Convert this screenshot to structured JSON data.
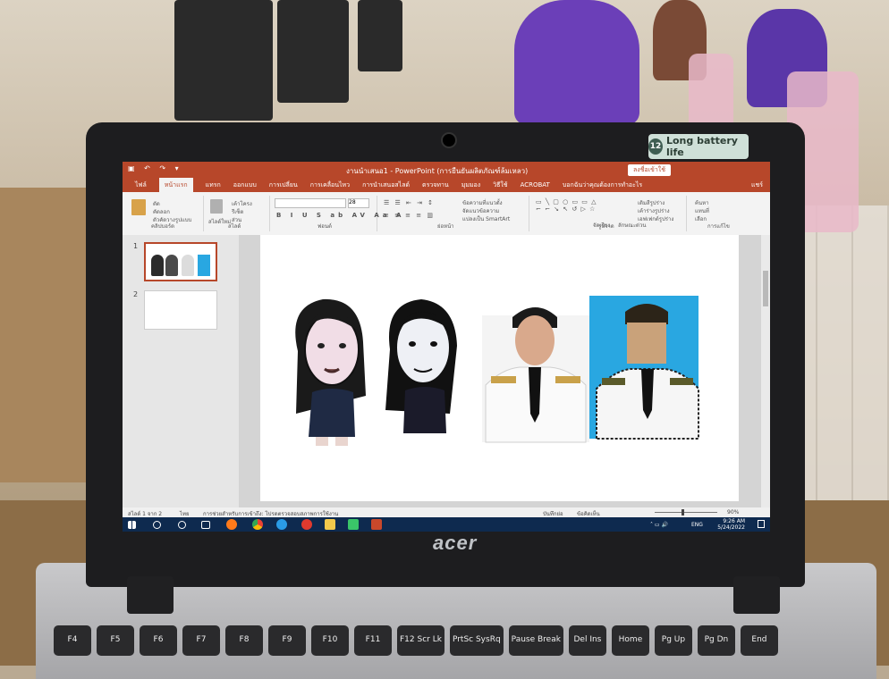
{
  "sticker": {
    "number": "12",
    "text": "Long battery life"
  },
  "brand": "acer",
  "powerpoint": {
    "window_title": "งานนำเสนอ1 - PowerPoint (การยืนยันผลิตภัณฑ์ล้มเหลว)",
    "sign_in_label": "ลงชื่อเข้าใช้",
    "tabs": [
      "ไฟล์",
      "หน้าแรก",
      "แทรก",
      "ออกแบบ",
      "การเปลี่ยน",
      "การเคลื่อนไหว",
      "การนำเสนอสไลด์",
      "ตรวจทาน",
      "มุมมอง",
      "วิธีใช้",
      "ACROBAT",
      "บอกฉันว่าคุณต้องการทำอะไร"
    ],
    "active_tab_index": 1,
    "share_label": "แชร์",
    "ribbon_groups": [
      "คลิปบอร์ด",
      "สไลด์",
      "ฟอนต์",
      "ย่อหน้า",
      "รูปวาด",
      "การแก้ไข"
    ],
    "ribbon_items": [
      "ตัด",
      "คัดลอก",
      "ตัวคัดวางรูปแบบ",
      "สไลด์ใหม่",
      "เค้าโครง",
      "รีเซ็ต",
      "ส่วน",
      "ข้อความที่แนวตั้ง",
      "จัดแนวข้อความ",
      "แปลงเป็น SmartArt",
      "จัดเรียง",
      "ลักษณะด่วน",
      "เติมสีรูปร่าง",
      "เค้าร่างรูปร่าง",
      "เอฟเฟกต์รูปร่าง",
      "ค้นหา",
      "แทนที่",
      "เลือก"
    ],
    "font_size": "28",
    "slides": [
      "1",
      "2"
    ],
    "status_slide": "สไลด์ 1 จาก 2",
    "status_lang": "ไทย",
    "status_accessibility": "การช่วยสำหรับการเข้าถึง: โปรดตรวจสอบสภาพการใช้งาน",
    "status_notes": "บันทึกย่อ",
    "status_comments": "ข้อคิดเห็น",
    "zoom": "90%"
  },
  "taskbar": {
    "lang": "ENG",
    "time": "9:26 AM",
    "date": "5/24/2022",
    "icons": [
      "windows-start-icon",
      "search-icon",
      "cortana-icon",
      "task-view-icon",
      "firefox-icon",
      "chrome-icon",
      "edge-icon",
      "acrobat-icon",
      "file-explorer-icon",
      "line-icon",
      "powerpoint-icon"
    ]
  },
  "keyboard": [
    "F4",
    "F5",
    "F6",
    "F7",
    "F8",
    "F9",
    "F10",
    "F11",
    "F12 Scr Lk",
    "PrtSc SysRq",
    "Pause Break",
    "Del Ins",
    "Home",
    "Pg Up",
    "Pg Dn",
    "End"
  ],
  "colors": {
    "ppt_accent": "#b7472a",
    "taskbar": "#0e2a4f",
    "photo_bg": "#29a7e1"
  }
}
